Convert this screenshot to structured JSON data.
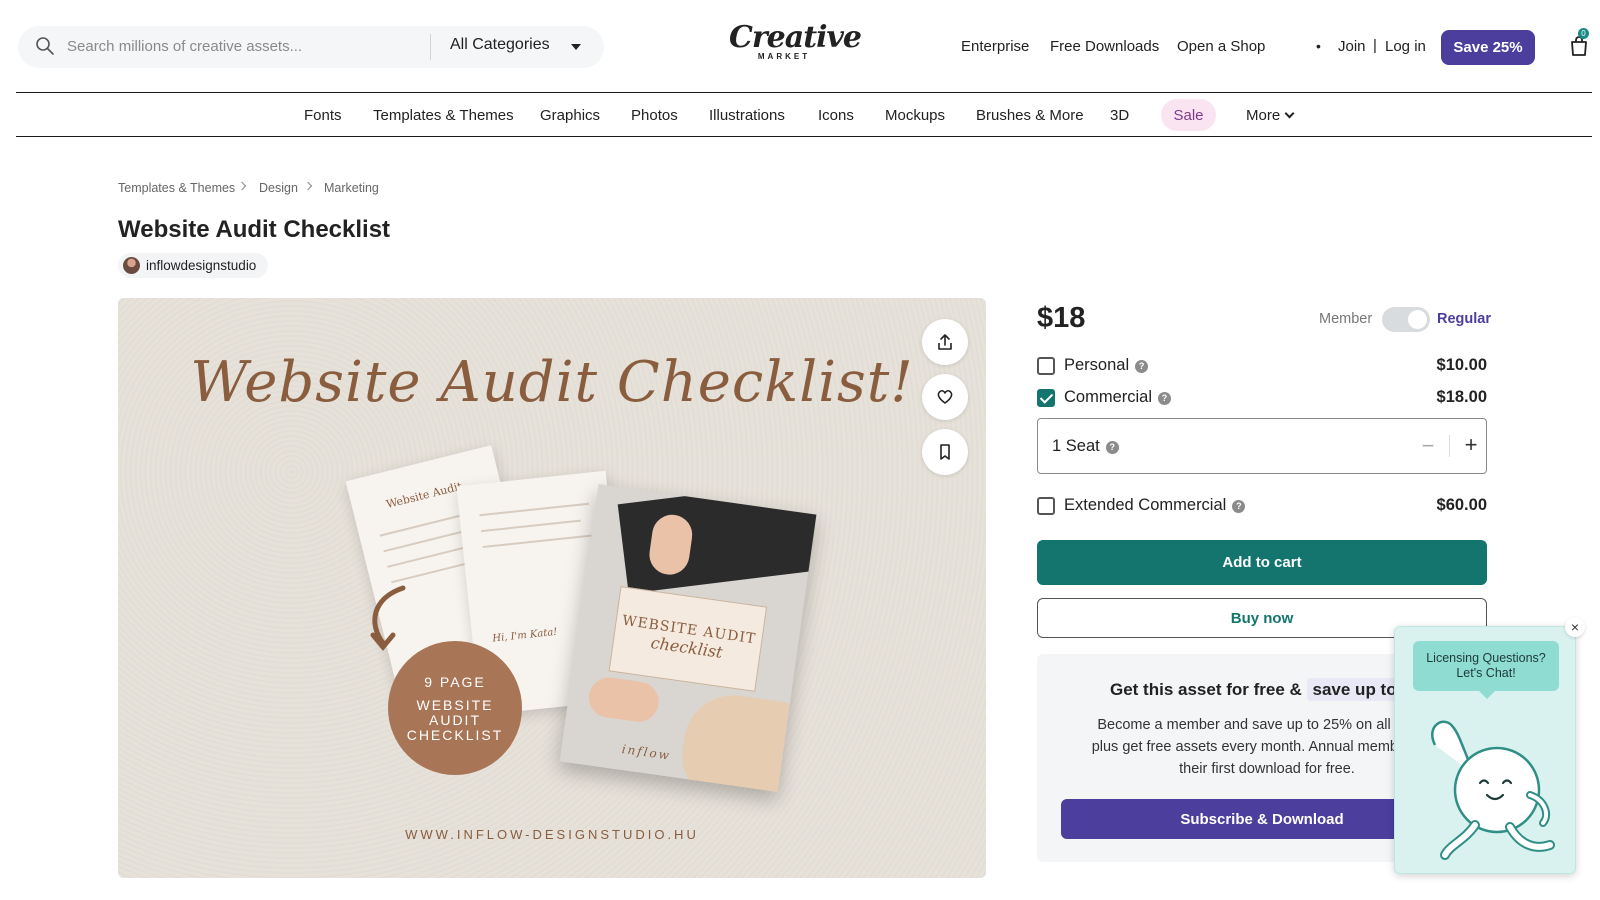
{
  "header": {
    "search_placeholder": "Search millions of creative assets...",
    "categories_label": "All Categories",
    "logo_script": "Creative",
    "logo_sub": "MARKET",
    "links": [
      "Enterprise",
      "Free Downloads",
      "Open a Shop"
    ],
    "dot": "•",
    "join": "Join",
    "separator": "|",
    "login": "Log in",
    "save_label": "Save 25%",
    "cart_count": "0"
  },
  "catnav": {
    "items": [
      "Fonts",
      "Templates & Themes",
      "Graphics",
      "Photos",
      "Illustrations",
      "Icons",
      "Mockups",
      "Brushes & More",
      "3D"
    ],
    "sale": "Sale",
    "more": "More"
  },
  "breadcrumb": [
    "Templates & Themes",
    "Design",
    "Marketing"
  ],
  "product": {
    "title": "Website Audit Checklist",
    "author": "inflowdesignstudio"
  },
  "hero": {
    "script_title": "Website Audit Checklist!",
    "card_line1": "WEBSITE AUDIT",
    "card_line2": "checklist",
    "badge_line1": "9 PAGE",
    "badge_line2": "WEBSITE",
    "badge_line3": "AUDIT",
    "badge_line4": "CHECKLIST",
    "url": "WWW.INFLOW-DESIGNSTUDIO.HU",
    "sheet1_head": "Website Audit",
    "sheet2_greet": "Hi, I'm Kata!",
    "card_brand": "inflow"
  },
  "pricing": {
    "price": "$18",
    "member_label": "Member",
    "regular_label": "Regular",
    "licenses": [
      {
        "name": "Personal",
        "price": "$10.00",
        "checked": false
      },
      {
        "name": "Commercial",
        "price": "$18.00",
        "checked": true
      },
      {
        "name": "Extended Commercial",
        "price": "$60.00",
        "checked": false
      }
    ],
    "seat_label": "1 Seat",
    "help_glyph": "?",
    "minus": "−",
    "plus": "+",
    "add_to_cart": "Add to cart",
    "buy_now": "Buy now"
  },
  "promo": {
    "title_a": "Get this asset for free &",
    "title_b": "save up to 25%",
    "body": "Become a member and save up to 25% on all assets plus get free assets every month. Annual members get their first download for free.",
    "cta": "Subscribe & Download"
  },
  "chat": {
    "line1": "Licensing Questions?",
    "line2": "Let's Chat!",
    "close": "×"
  },
  "colors": {
    "brand_purple": "#4c3e9d",
    "teal": "#14756f",
    "sale_bg": "#fbe4f1",
    "chat_bg": "#d9f2f0"
  }
}
